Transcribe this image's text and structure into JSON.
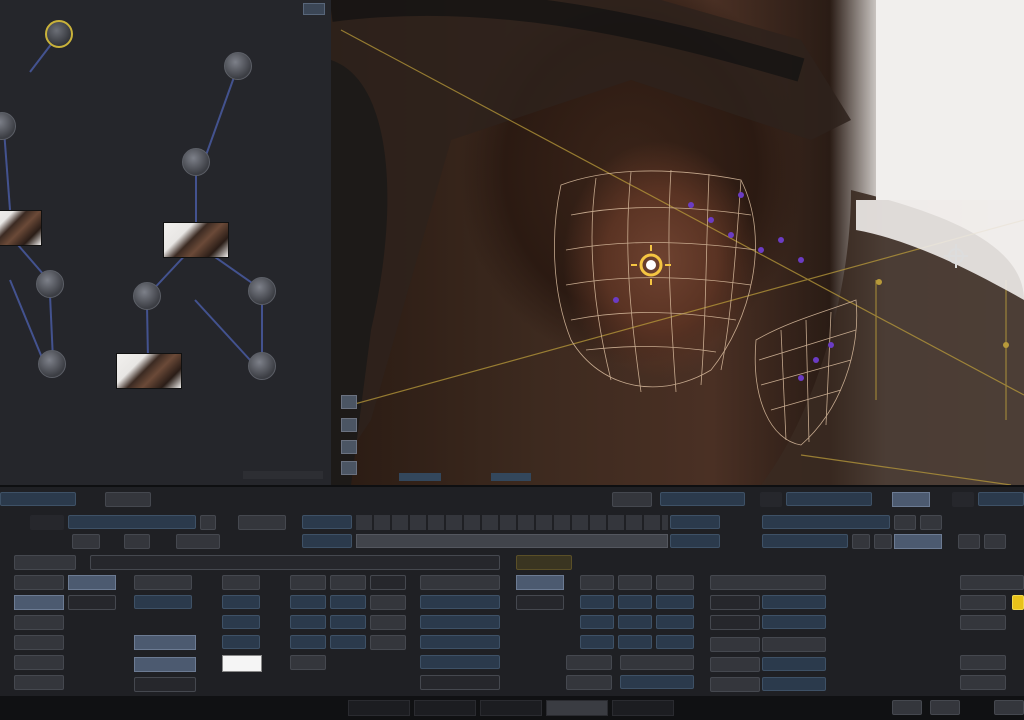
{
  "colors": {
    "node_selected_ring": "#c9b23a",
    "link": "#4b5ea8",
    "mesh": "#d4b79a",
    "mesh_point": "#6b3cc4",
    "tracker_center": "#f5c542",
    "guide_line": "#b89a3a",
    "highlight_button": "#e8c21a"
  },
  "node_graph": {
    "nodes": [
      {
        "id": "source-top",
        "icon": "node-sphere-icon",
        "selected": true
      },
      {
        "id": "right-top",
        "icon": "node-sphere-icon"
      },
      {
        "id": "left-edge",
        "icon": "node-sphere-icon"
      },
      {
        "id": "center-mid",
        "icon": "node-sphere-icon"
      },
      {
        "id": "left-a",
        "icon": "node-sphere-icon"
      },
      {
        "id": "center-left",
        "icon": "node-sphere-icon"
      },
      {
        "id": "center-right",
        "icon": "node-sphere-icon"
      },
      {
        "id": "left-bottom",
        "icon": "node-sphere-icon"
      },
      {
        "id": "right-bottom",
        "icon": "node-sphere-icon"
      }
    ],
    "thumbnails": [
      "face-thumbnail",
      "face-thumbnail",
      "face-thumbnail"
    ]
  },
  "viewer": {
    "icons": [
      "lock-icon",
      "grid-icon",
      "channels-icon",
      "play-icon"
    ],
    "target_icon": "gear-target-icon",
    "tracker_icon": "tracker-sun-icon"
  },
  "panel": {
    "highlight": "shading-button-active"
  },
  "tabs": [
    {
      "id": "tab-1",
      "active": false
    },
    {
      "id": "tab-2",
      "active": false
    },
    {
      "id": "tab-3",
      "active": false
    },
    {
      "id": "tab-4",
      "active": true
    },
    {
      "id": "tab-5",
      "active": false
    }
  ]
}
